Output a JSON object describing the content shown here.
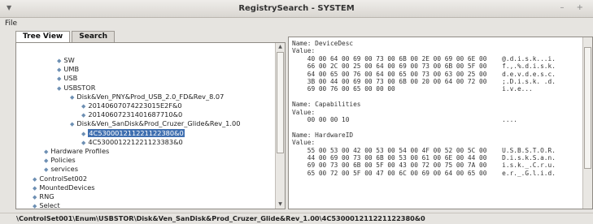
{
  "window": {
    "title": "RegistrySearch - SYSTEM",
    "menu": [
      "File"
    ],
    "win_controls": "– +"
  },
  "tabs": [
    {
      "label": "Tree View",
      "active": true
    },
    {
      "label": "Search",
      "active": false
    }
  ],
  "tree": [
    {
      "label": "SW",
      "depth": 2
    },
    {
      "label": "UMB",
      "depth": 2
    },
    {
      "label": "USB",
      "depth": 2
    },
    {
      "label": "USBSTOR",
      "depth": 2
    },
    {
      "label": "Disk&Ven_PNY&Prod_USB_2.0_FD&Rev_8.07",
      "depth": 3
    },
    {
      "label": "20140607074223015E2F&0",
      "depth": 4
    },
    {
      "label": "20140607231401687710&0",
      "depth": 4
    },
    {
      "label": "Disk&Ven_SanDisk&Prod_Cruzer_Glide&Rev_1.00",
      "depth": 3
    },
    {
      "label": "4C530001211221122380&0",
      "depth": 4,
      "selected": true
    },
    {
      "label": "4C530001221221123383&0",
      "depth": 4
    },
    {
      "label": "Hardware Profiles",
      "depth": 1
    },
    {
      "label": "Policies",
      "depth": 1
    },
    {
      "label": "services",
      "depth": 1
    },
    {
      "label": "ControlSet002",
      "depth": 0
    },
    {
      "label": "MountedDevices",
      "depth": 0
    },
    {
      "label": "RNG",
      "depth": 0
    },
    {
      "label": "Select",
      "depth": 0
    }
  ],
  "values": [
    "Name: DeviceDesc",
    "Value:",
    "    40 00 64 00 69 00 73 00 6B 00 2E 00 69 00 6E 00    @.d.i.s.k...i.",
    "    66 00 2C 00 25 00 64 00 69 00 73 00 6B 00 5F 00    f.,.%.d.i.s.k.",
    "    64 00 65 00 76 00 64 00 65 00 73 00 63 00 25 00    d.e.v.d.e.s.c.",
    "    3B 00 44 00 69 00 73 00 6B 00 20 00 64 00 72 00    ;.D.i.s.k. .d.",
    "    69 00 76 00 65 00 00 00                            i.v.e...",
    "",
    "Name: Capabilities",
    "Value:",
    "    00 00 00 10                                        ....",
    "",
    "Name: HardwareID",
    "Value:",
    "    55 00 53 00 42 00 53 00 54 00 4F 00 52 00 5C 00    U.S.B.S.T.O.R.",
    "    44 00 69 00 73 00 6B 00 53 00 61 00 6E 00 44 00    D.i.s.k.S.a.n.",
    "    69 00 73 00 6B 00 5F 00 43 00 72 00 75 00 7A 00    i.s.k._.C.r.u.",
    "    65 00 72 00 5F 00 47 00 6C 00 69 00 64 00 65 00    e.r._.G.l.i.d."
  ],
  "status_path": "\\ControlSet001\\Enum\\USBSTOR\\Disk&Ven_SanDisk&Prod_Cruzer_Glide&Rev_1.00\\4C530001211221122380&0",
  "colors": {
    "selection": "#3f6fb0",
    "desktop": "#6aa7c9"
  },
  "icons": {
    "tree_node": "◆",
    "menu_arrow": "▼",
    "scroll_up": "▲",
    "scroll_down": "▼"
  }
}
